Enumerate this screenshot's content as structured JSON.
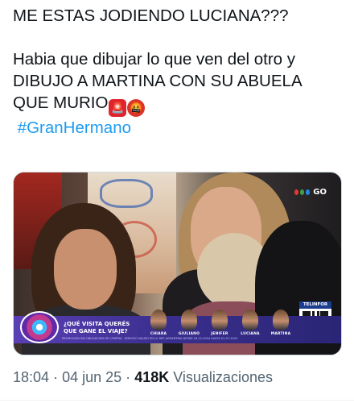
{
  "tweet": {
    "line1": "ME ESTAS JODIENDO LUCIANA???",
    "line2": "Habia que dibujar lo que ven del otro y",
    "line3": "DIBUJO A MARTINA CON SU ABUELA",
    "line4": "QUE MURIO",
    "emoji1": "🚨",
    "emoji2": "🤬",
    "hashtag": "#GranHermano"
  },
  "media": {
    "channel_logo_text": "GO",
    "question": "¿QUÉ VISITA QUERÉS QUE GANE EL VIAJE?",
    "contestants": [
      "CHIARA",
      "GIULIANO",
      "JENIFER",
      "LUCIANA",
      "MARTINA"
    ],
    "sponsor": "TELINFOR",
    "fine_print": "PROMOCIÓN SIN OBLIGACIÓN DE COMPRA · SERVICIO VÁLIDO EN LA REP. ARGENTINA DESDE 04-12-2024 HASTA 01-07-2025",
    "logo_colors": [
      "#e53935",
      "#43a047",
      "#1e88e5"
    ]
  },
  "meta": {
    "time": "18:04",
    "sep1": "·",
    "date": "04 jun 25",
    "sep2": "·",
    "views": "418K",
    "views_label": "Visualizaciones"
  }
}
